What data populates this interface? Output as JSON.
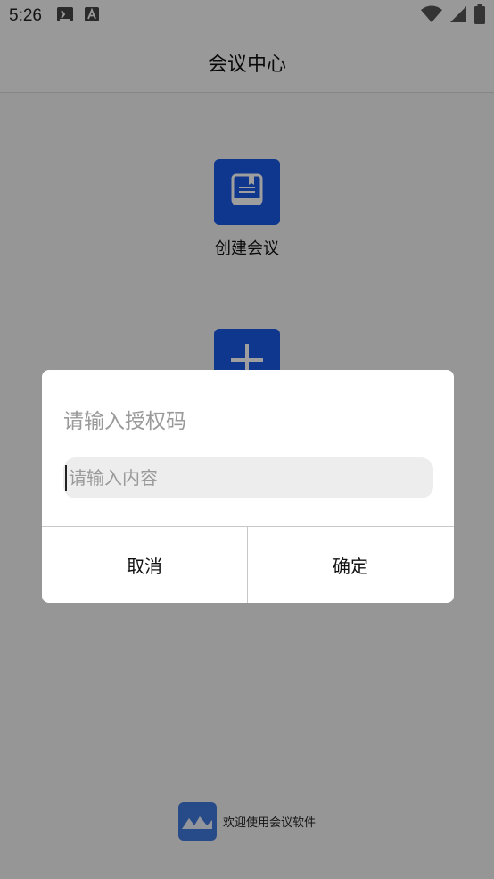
{
  "status_bar": {
    "time": "5:26",
    "icons": [
      "voicemail-icon",
      "text-a-icon"
    ],
    "right_icons": [
      "wifi-icon",
      "signal-icon",
      "battery-icon"
    ]
  },
  "app_bar": {
    "title": "会议中心"
  },
  "actions": [
    {
      "label": "创建会议",
      "icon": "book-icon"
    },
    {
      "label": "",
      "icon": "plus-icon"
    }
  ],
  "footer": {
    "text": "欢迎使用会议软件",
    "logo_icon": "mountain-logo-icon"
  },
  "dialog": {
    "title": "请输入授权码",
    "input_value": "",
    "input_placeholder": "请输入内容",
    "cancel_label": "取消",
    "confirm_label": "确定"
  },
  "colors": {
    "accent": "#1a5ae6",
    "logo": "#3f78de",
    "scrim": "rgba(0,0,0,0.38)"
  }
}
